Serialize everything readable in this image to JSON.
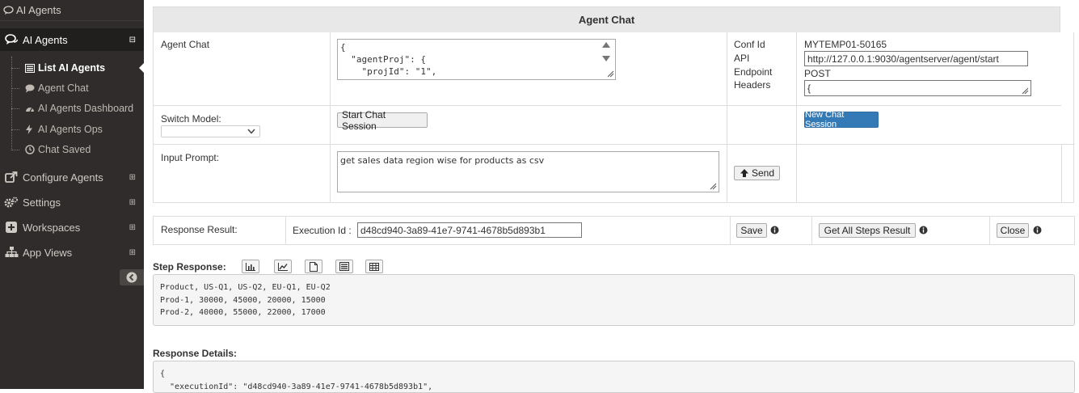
{
  "sidebar": {
    "top_label": "AI Agents",
    "section_label": "AI Agents",
    "section_toggle": "⊟",
    "sub_items": [
      {
        "label": "List AI Agents",
        "icon": "list-icon"
      },
      {
        "label": "Agent Chat",
        "icon": "chat-bubble-icon"
      },
      {
        "label": "AI Agents Dashboard",
        "icon": "dashboard-icon"
      },
      {
        "label": "AI Agents Ops",
        "icon": "bolt-icon"
      },
      {
        "label": "Chat Saved",
        "icon": "clock-icon"
      }
    ],
    "items": [
      {
        "label": "Configure Agents",
        "icon": "external-link-icon",
        "toggle": "⊞"
      },
      {
        "label": "Settings",
        "icon": "gears-icon",
        "toggle": "⊞"
      },
      {
        "label": "Workspaces",
        "icon": "plus-square-icon",
        "toggle": "⊞"
      },
      {
        "label": "App Views",
        "icon": "sitemap-icon",
        "toggle": "⊞"
      }
    ]
  },
  "agent_chat": {
    "title": "Agent Chat",
    "agent_chat_label": "Agent Chat",
    "agent_chat_json": "{\n  \"agentProj\": {\n    \"projId\": \"1\",",
    "conf_id_label": "Conf Id",
    "conf_id_value": "MYTEMP01-50165",
    "api_endpoint_label": "API\nEndpoint",
    "api_endpoint_value": "http://127.0.0.1:9030/agentserver/agent/start",
    "method_value": "POST",
    "headers_label": "Headers",
    "headers_value": "{",
    "switch_model_label": "Switch Model:",
    "start_chat_button": "Start Chat Session",
    "new_chat_button": "New Chat Session",
    "input_prompt_label": "Input Prompt:",
    "input_prompt_value": "get sales data region wise for products as csv",
    "send_button": "Send"
  },
  "response": {
    "result_label": "Response Result:",
    "execution_id_label": "Execution Id :",
    "execution_id_value": "d48cd940-3a89-41e7-9741-4678b5d893b1",
    "save_button": "Save",
    "get_all_steps_button": "Get All Steps Result",
    "close_button": "Close",
    "step_response_label": "Step Response:",
    "step_response_lines": [
      "Product, US-Q1, US-Q2, EU-Q1, EU-Q2",
      "Prod-1, 30000, 45000, 20000, 15000",
      "Prod-2, 40000, 55000, 22000, 17000"
    ],
    "response_details_label": "Response Details:",
    "response_details_lines": [
      "{",
      "  \"executionId\": \"d48cd940-3a89-41e7-9741-4678b5d893b1\","
    ]
  },
  "colors": {
    "sidebar_bg": "#2f2c2b",
    "accent_blue": "#337ab7"
  }
}
